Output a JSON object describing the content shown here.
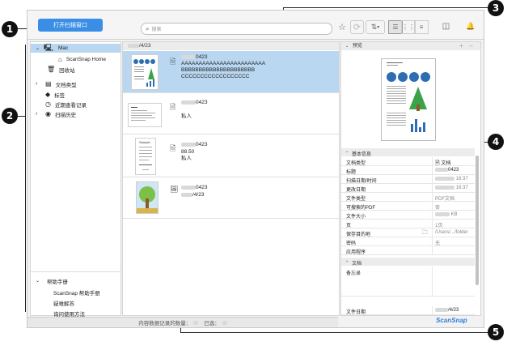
{
  "toolbar": {
    "open_scan_window_label": "打开扫描窗口",
    "search_placeholder": "搜索"
  },
  "icons": {
    "bookmark": "☆",
    "sync": "⟳",
    "sort": "⇅",
    "notify": "🔔",
    "folder": "🗀",
    "add": "+",
    "expand": "↔"
  },
  "sidebar": {
    "mac_label": "Mac",
    "scansnap_home_label": "ScanSnap Home",
    "trash_label": "回收站",
    "doc_type_label": "文档类型",
    "tags_label": "标签",
    "recent_label": "近期查看记录",
    "history_label": "扫描历史",
    "help_header_label": "帮助手册",
    "help_items": [
      "ScanSnap 帮助手册",
      "疑难解答",
      "询问使用方法"
    ]
  },
  "list": {
    "header_date": "/4/23",
    "rows": [
      {
        "title": "0423",
        "lines": [
          "AAAAAAAAAAAAAAAAAAAAAAAA",
          "BBBBBBBBBBBBBBBBBBBBB",
          "CCCCCCCCCCCCCCCCCC"
        ]
      },
      {
        "title": "0423",
        "lines": [
          "私人"
        ]
      },
      {
        "title": "0423",
        "lines": [
          "88.50",
          "私人"
        ]
      },
      {
        "title": "",
        "lines": [
          "0423",
          "/4/23"
        ]
      }
    ],
    "thumb_sample_label": "Sample"
  },
  "panel": {
    "preview_label": "预览",
    "basic_info_label": "基本信息",
    "properties": [
      {
        "key": "文档类型",
        "value": "文档"
      },
      {
        "key": "标题",
        "value": "0423"
      },
      {
        "key": "扫描日期/时间",
        "value": "16:37"
      },
      {
        "key": "更改日期",
        "value": "16:37"
      },
      {
        "key": "文件类型",
        "value": "PDF文档"
      },
      {
        "key": "可搜索的PDF",
        "value": "否"
      },
      {
        "key": "文件大小",
        "value": "KB"
      },
      {
        "key": "页",
        "value": "1页"
      },
      {
        "key": "保存目的地",
        "value": "/Users/.../folder"
      },
      {
        "key": "密码",
        "value": "无"
      },
      {
        "key": "应用程序",
        "value": ""
      }
    ],
    "doc_section_label": "文档",
    "memo_label": "备忘录",
    "doc_date_label": "文件日期",
    "doc_date_value": "/4/23"
  },
  "status": {
    "count_label": "内容数据记录的数量：",
    "selected_label": "已选："
  },
  "brand": {
    "logo_text": "ScanSnap",
    "logo_color": "#2f7fd6"
  },
  "callouts": [
    "1",
    "2",
    "3",
    "4",
    "5"
  ],
  "colors": {
    "accent": "#3a8ee6",
    "selected_row": "#b9d7f0",
    "callout": "#111111"
  }
}
